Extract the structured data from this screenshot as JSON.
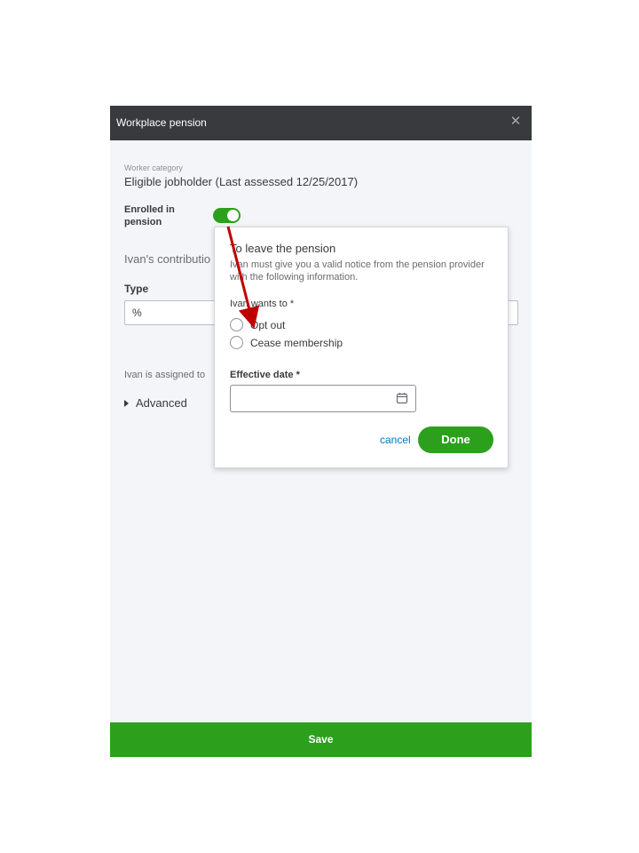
{
  "panel": {
    "title": "Workplace pension",
    "close_symbol": "✕",
    "worker_category_label": "Worker category",
    "worker_category_value": "Eligible jobholder (Last assessed 12/25/2017)",
    "enrolled_label": "Enrolled in pension",
    "enrolled": true,
    "contribution_text": "Ivan's contributio",
    "type_label": "Type",
    "type_value": "%",
    "assigned_text": "Ivan is assigned to",
    "advanced_label": "Advanced",
    "save_label": "Save"
  },
  "popover": {
    "title": "To leave the pension",
    "description": "Ivan must give you a valid notice from the pension provider with the following information.",
    "wants_label": "Ivan wants to *",
    "options": [
      "Opt out",
      "Cease membership"
    ],
    "effective_date_label": "Effective date *",
    "effective_date_value": "",
    "cancel_label": "cancel",
    "done_label": "Done"
  },
  "annotation": {
    "arrow_color": "#c00000"
  },
  "icons": {
    "close": "close-icon",
    "calendar": "calendar-icon",
    "advanced": "triangle-right-icon"
  },
  "colors": {
    "header": "#393a3d",
    "accent_green": "#2ca01c",
    "link_blue": "#0077c5",
    "panel_bg": "#f4f5f8"
  }
}
